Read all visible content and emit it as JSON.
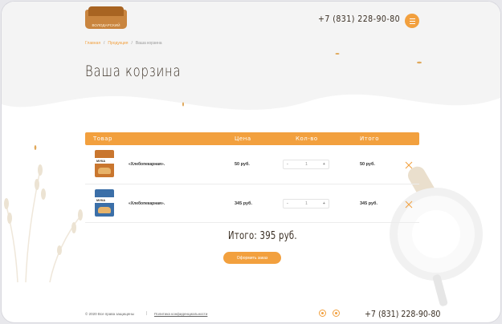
{
  "header": {
    "logo_text": "ВОЛОДАРСКИЙ",
    "phone": "+7 (831) 228-90-80"
  },
  "breadcrumb": {
    "home": "Главная",
    "products": "Продукция",
    "current": "Ваша корзина",
    "separator": "/"
  },
  "page_title": "Ваша корзина",
  "table": {
    "headers": {
      "product": "Товар",
      "price": "Цена",
      "qty": "Кол-во",
      "total": "Итого"
    },
    "rows": [
      {
        "name": "«Хлебопекарная».",
        "price": "50 руб.",
        "qty": "1",
        "total": "50 руб.",
        "minus": "-",
        "plus": "+",
        "brand": "МУКА",
        "pack_color": "#c9762e"
      },
      {
        "name": "«Хлебопекарная».",
        "price": "345 руб.",
        "qty": "1",
        "total": "345 руб.",
        "minus": "-",
        "plus": "+",
        "brand": "МУКА",
        "pack_color": "#3b6fa8"
      }
    ]
  },
  "summary": {
    "total": "Итого: 395 руб.",
    "order_button": "Оформить заказ"
  },
  "footer": {
    "copyright": "© 2020 Все права защищены",
    "separator": "|",
    "privacy": "Политика конфиденциальности",
    "phone": "+7 (831) 228-90-80",
    "social_icons": [
      "vk-icon",
      "ok-icon"
    ]
  },
  "colors": {
    "accent": "#f2a03e",
    "text_dark": "#3a2f24"
  }
}
